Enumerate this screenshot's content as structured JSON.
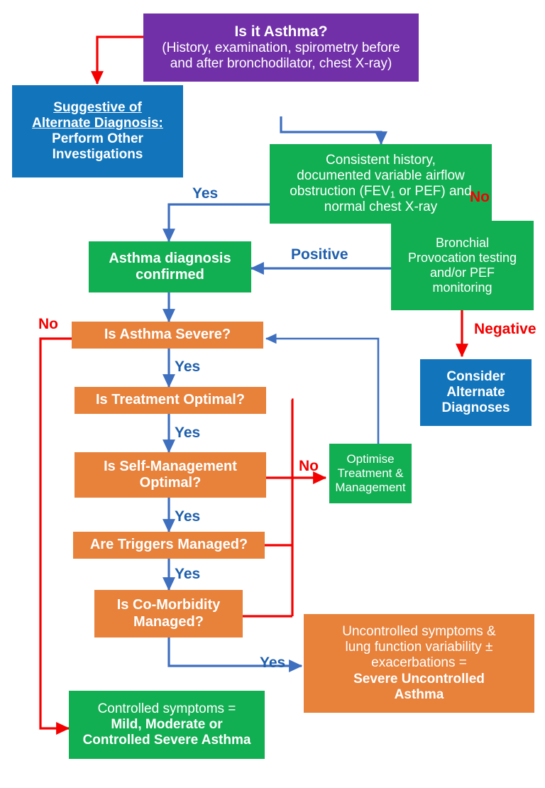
{
  "diagram": {
    "title": "Asthma diagnosis and severity assessment flowchart",
    "colors": {
      "purple": "#7230A8",
      "green": "#12AE52",
      "blue": "#1275BC",
      "orange": "#E8813A",
      "arrow_blue": "#3F6FBF",
      "arrow_red": "#F50000",
      "label_blue": "#1F5FAD",
      "label_red": "#F50000",
      "background": "#FFFFFF"
    },
    "nodes": {
      "is_it_asthma": {
        "heading": "Is it Asthma?",
        "line2": "(History, examination, spirometry  before",
        "line3": "and after bronchodilator, chest X-ray)"
      },
      "suggestive_alternate": {
        "line1": "Suggestive of",
        "line2": "Alternate Diagnosis:",
        "line3": "Perform Other",
        "line4": "Investigations"
      },
      "consistent_history": {
        "line1": "Consistent history,",
        "line2": "documented variable airflow",
        "line3_a": "obstruction (FEV",
        "line3_sub": "1",
        "line3_b": " or PEF) and",
        "line4": "normal chest X-ray"
      },
      "bronchial_provocation": {
        "line1": "Bronchial",
        "line2": "Provocation testing",
        "line3": "and/or PEF",
        "line4": "monitoring"
      },
      "asthma_confirmed": {
        "line1": "Asthma diagnosis",
        "line2": "confirmed"
      },
      "consider_alternate": {
        "line1": "Consider",
        "line2": "Alternate",
        "line3": "Diagnoses"
      },
      "is_asthma_severe": {
        "label": "Is Asthma Severe?"
      },
      "is_treatment_optimal": {
        "label": "Is Treatment Optimal?"
      },
      "is_self_management_optimal": {
        "line1": "Is Self-Management",
        "line2": "Optimal?"
      },
      "are_triggers_managed": {
        "label": "Are Triggers Managed?"
      },
      "is_comorbidity_managed": {
        "line1": "Is Co-Morbidity",
        "line2": "Managed?"
      },
      "optimise_treatment": {
        "line1": "Optimise",
        "line2": "Treatment &",
        "line3": "Management"
      },
      "controlled_symptoms": {
        "line1": "Controlled symptoms =",
        "line2": "Mild, Moderate or",
        "line3": "Controlled Severe Asthma"
      },
      "uncontrolled_symptoms": {
        "line1": "Uncontrolled symptoms &",
        "line2": "lung function variability ±",
        "line3": "exacerbations =",
        "line4": "Severe Uncontrolled",
        "line5": "Asthma"
      }
    },
    "edge_labels": {
      "yes_top": "Yes",
      "no_top": "No",
      "positive": "Positive",
      "negative": "Negative",
      "no_severe": "No",
      "yes_severe": "Yes",
      "yes_treatment": "Yes",
      "yes_selfmgmt": "Yes",
      "yes_triggers": "Yes",
      "no_optimise": "No",
      "yes_comorbidity": "Yes"
    }
  }
}
